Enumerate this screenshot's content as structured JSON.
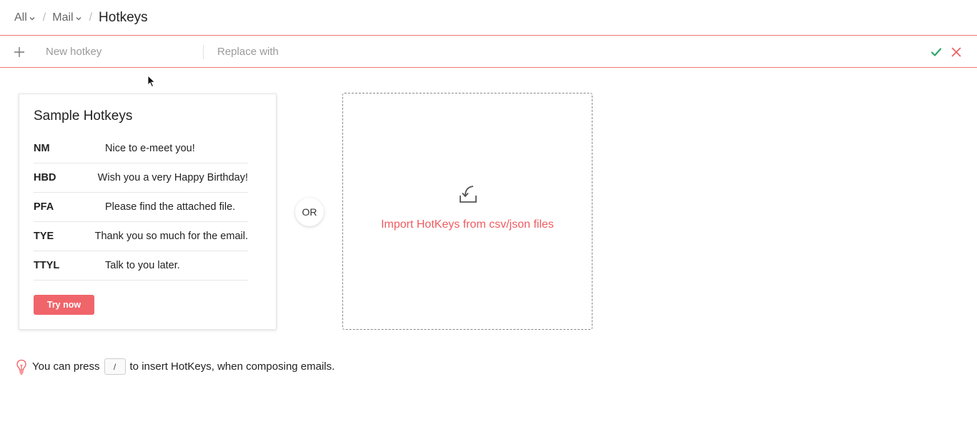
{
  "breadcrumb": {
    "items": [
      "All",
      "Mail"
    ],
    "current": "Hotkeys",
    "separator": "/"
  },
  "hotkey_bar": {
    "new_hotkey_placeholder": "New hotkey",
    "replace_with_placeholder": "Replace with",
    "add_icon": "plus-icon",
    "confirm_icon": "check-icon",
    "cancel_icon": "close-icon"
  },
  "sample": {
    "title": "Sample Hotkeys",
    "rows": [
      {
        "key": "NM",
        "value": "Nice to e-meet you!"
      },
      {
        "key": "HBD",
        "value": "Wish you a very Happy Birthday!"
      },
      {
        "key": "PFA",
        "value": "Please find the attached file."
      },
      {
        "key": "TYE",
        "value": "Thank you so much for the email."
      },
      {
        "key": "TTYL",
        "value": "Talk to you later."
      }
    ],
    "button_label": "Try now"
  },
  "or_label": "OR",
  "import": {
    "label": "Import HotKeys from csv/json files",
    "icon": "import-tray-icon"
  },
  "tip": {
    "before": "You can press",
    "key": "/",
    "after": "to insert HotKeys, when composing emails.",
    "icon": "lightbulb-icon"
  },
  "colors": {
    "accent": "#f0656a",
    "link": "#ef5b60",
    "confirm": "#2ea86b",
    "border_accent": "#f0777a"
  }
}
